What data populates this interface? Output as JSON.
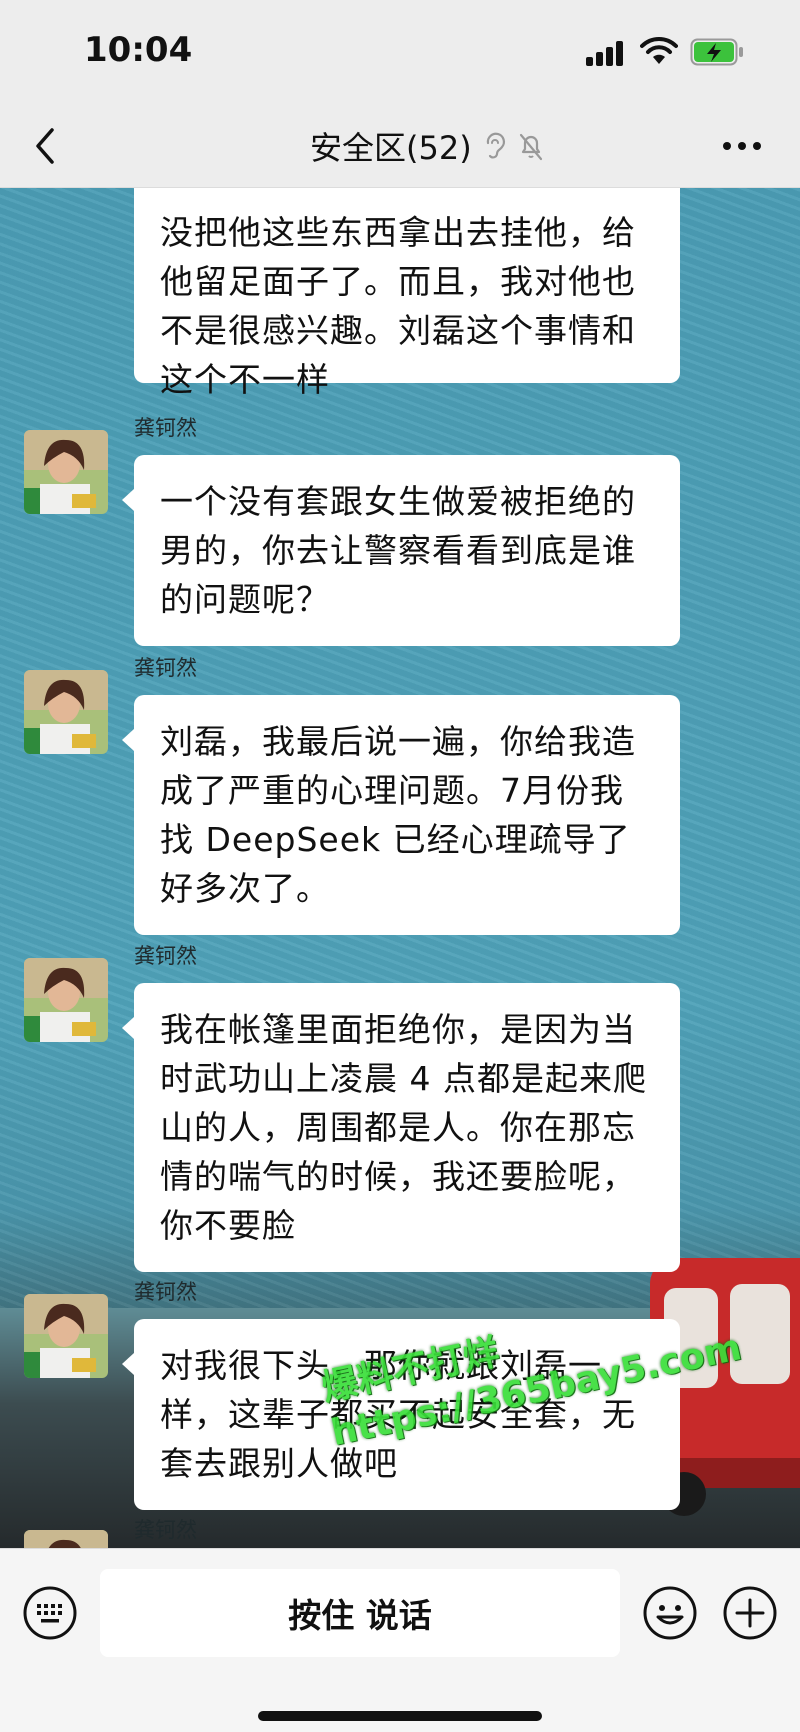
{
  "status_bar": {
    "time": "10:04"
  },
  "header": {
    "title": "安全区(52)"
  },
  "sender_name": "龚钶然",
  "messages": [
    {
      "text": "没把他这些东西拿出去挂他，给他留足面子了。而且，我对他也不是很感兴趣。刘磊这个事情和这个不一样"
    },
    {
      "sender": "龚钶然",
      "text": "一个没有套跟女生做爱被拒绝的男的，你去让警察看看到底是谁的问题呢？"
    },
    {
      "sender": "龚钶然",
      "text": "刘磊，我最后说一遍，你给我造成了严重的心理问题。7月份我找 DeepSeek 已经心理疏导了好多次了。"
    },
    {
      "sender": "龚钶然",
      "text": "我在帐篷里面拒绝你，是因为当时武功山上凌晨 4 点都是起来爬山的人，周围都是人。你在那忘情的喘气的时候，我还要脸呢，你不要脸"
    },
    {
      "sender": "龚钶然",
      "text": "对我很下头，那你就跟刘磊一样，这辈子都买不起安全套，无套去跟别人做吧"
    },
    {
      "sender": "龚钶然"
    }
  ],
  "watermark": {
    "line1": "爆料不打烊",
    "line2": "https://365bay5.com"
  },
  "input_bar": {
    "talk_label": "按住 说话"
  },
  "icons": {
    "back": "chevron-left-icon",
    "ear": "ear-icon",
    "mute": "mute-bell-icon",
    "more": "more-icon",
    "keyboard": "keyboard-icon",
    "emoji": "emoji-icon",
    "plus": "plus-icon"
  },
  "colors": {
    "chat_bg": "#4e9fb6",
    "bubble": "#ffffff",
    "bar": "#ededed",
    "watermark": "#3adf3a"
  }
}
